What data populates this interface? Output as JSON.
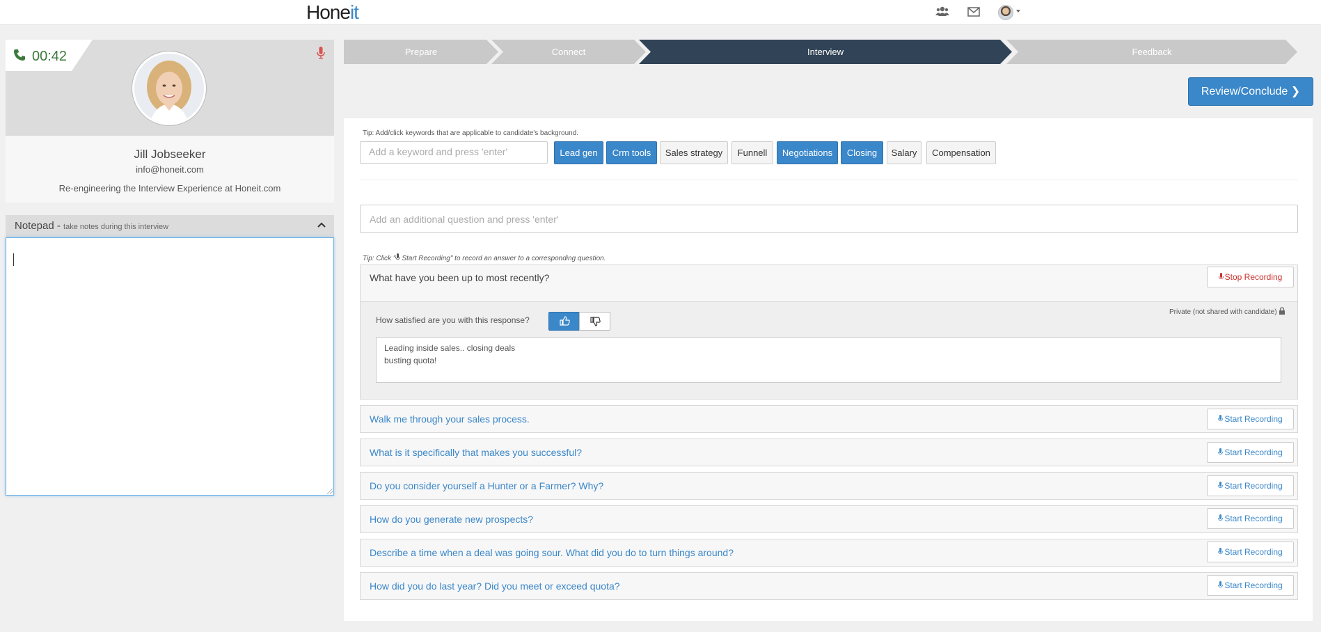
{
  "app": {
    "logo_prefix": "Hone",
    "logo_suffix": "it",
    "nav_icons": [
      "people-icon",
      "envelope-icon",
      "user-avatar-menu"
    ]
  },
  "candidate": {
    "timer": "00:42",
    "name": "Jill Jobseeker",
    "email": "info@honeit.com",
    "headline": "Re-engineering the Interview Experience at Honeit.com"
  },
  "notepad": {
    "title": "Notepad - ",
    "subtitle": "take notes during this interview",
    "value": ""
  },
  "steps": [
    {
      "label": "Prepare",
      "state": "inactive"
    },
    {
      "label": "Connect",
      "state": "inactive"
    },
    {
      "label": "Interview",
      "state": "active"
    },
    {
      "label": "Feedback",
      "state": "inactive"
    }
  ],
  "actions": {
    "review_conclude": "Review/Conclude"
  },
  "keywords": {
    "tip": "Tip: Add/click keywords that are applicable to candidate's background.",
    "placeholder": "Add a keyword and press 'enter'",
    "items": [
      {
        "label": "Lead gen",
        "selected": true
      },
      {
        "label": "Crm tools",
        "selected": true
      },
      {
        "label": "Sales strategy",
        "selected": false
      },
      {
        "label": "Funnell",
        "selected": false
      },
      {
        "label": "Negotiations",
        "selected": true
      },
      {
        "label": "Closing",
        "selected": true
      },
      {
        "label": "Salary",
        "selected": false
      },
      {
        "label": "Compensation",
        "selected": false
      }
    ]
  },
  "questions_section": {
    "add_placeholder": "Add an additional question and press 'enter'",
    "tip_prefix": "Tip: Click \"",
    "tip_suffix": "Start Recording\" to record an answer to a corresponding question.",
    "start_label": "Start Recording",
    "stop_label": "Stop Recording",
    "active": {
      "question": "What have you been up to most recently?",
      "satisfaction_prompt": "How satisfied are you with this response?",
      "thumbs_up_selected": true,
      "private_note": "Private (not shared with candidate)",
      "answer": "Leading inside sales.. closing deals\nbusting quota!"
    },
    "questions": [
      "Walk me through your sales process.",
      "What is it specifically that makes you successful?",
      "Do you consider yourself a Hunter or a Farmer? Why?",
      "How do you generate new prospects?",
      "Describe a time when a deal was going sour. What did you do to turn things around?",
      "How did you do last year? Did you meet or exceed quota?"
    ]
  },
  "colors": {
    "accent": "#3a87c9",
    "step_active": "#314356",
    "step_inactive": "#c9c9c9",
    "timer_green": "#3b7a3a",
    "stop_red": "#c9302c"
  }
}
